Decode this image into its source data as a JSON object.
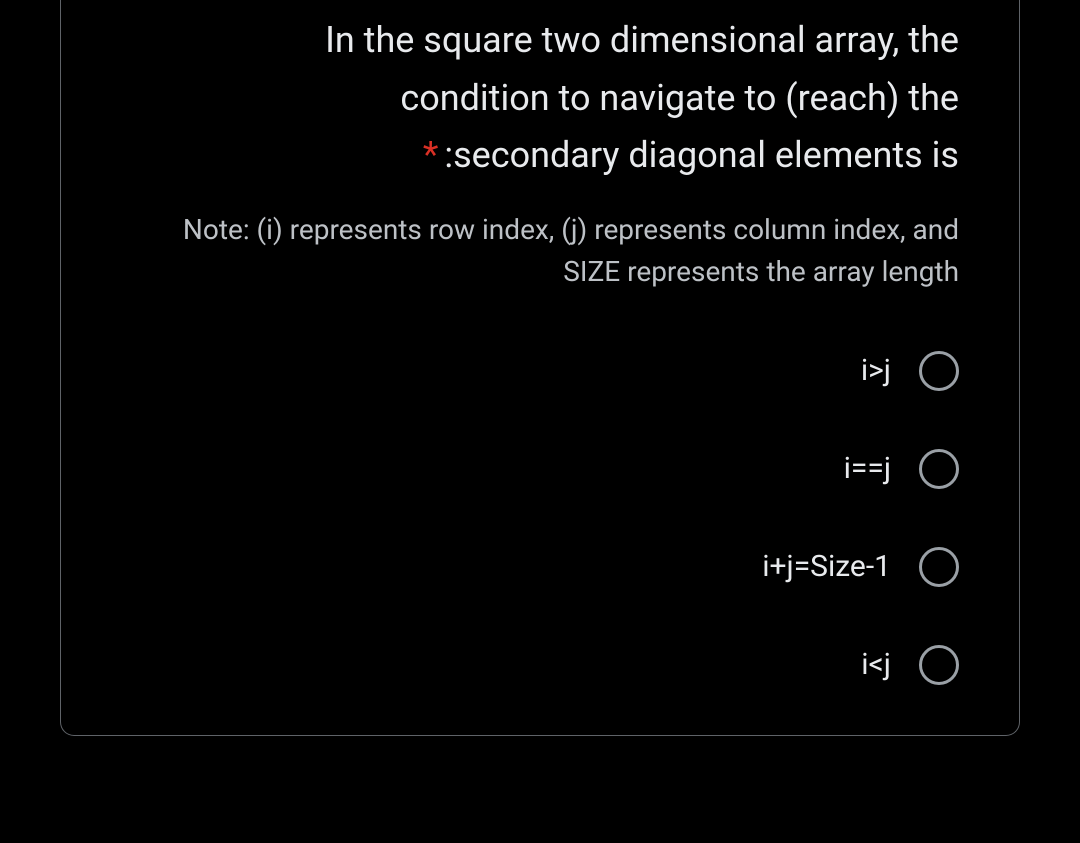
{
  "question": {
    "line1": "In the square two dimensional array, the",
    "line2": "condition to navigate to (reach) the",
    "line3": ":secondary diagonal elements is",
    "required_marker": "*"
  },
  "note": "Note: (i) represents row index, (j) represents column index, and SIZE represents the array length",
  "options": [
    {
      "label": "i>j"
    },
    {
      "label": "i==j"
    },
    {
      "label": "i+j=Size-1"
    },
    {
      "label": "i<j"
    }
  ]
}
